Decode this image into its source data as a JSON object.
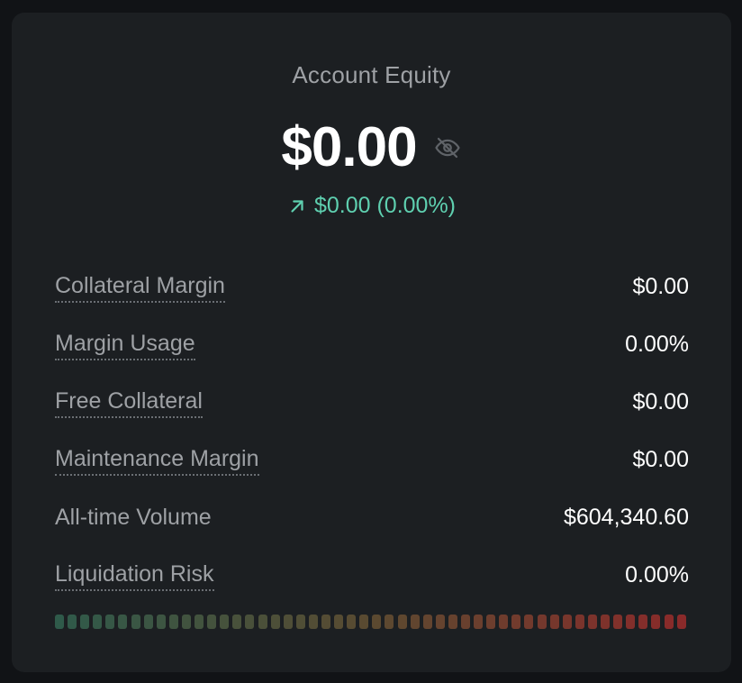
{
  "card": {
    "title": "Account Equity",
    "equity": "$0.00",
    "change": "$0.00 (0.00%)",
    "accent_color": "#5fd0b0",
    "icons": {
      "visibility": "eye-off-icon",
      "change": "arrow-up-right-icon"
    }
  },
  "stats": [
    {
      "label": "Collateral Margin",
      "value": "$0.00",
      "tooltip": true
    },
    {
      "label": "Margin Usage",
      "value": "0.00%",
      "tooltip": true
    },
    {
      "label": "Free Collateral",
      "value": "$0.00",
      "tooltip": true
    },
    {
      "label": "Maintenance Margin",
      "value": "$0.00",
      "tooltip": true
    },
    {
      "label": "All-time Volume",
      "value": "$604,340.60",
      "tooltip": false
    },
    {
      "label": "Liquidation Risk",
      "value": "0.00%",
      "tooltip": true
    }
  ],
  "risk_meter": {
    "level": 0,
    "segments": 50,
    "start_color": "#2f5a4a",
    "end_color": "#8a2a2a"
  }
}
